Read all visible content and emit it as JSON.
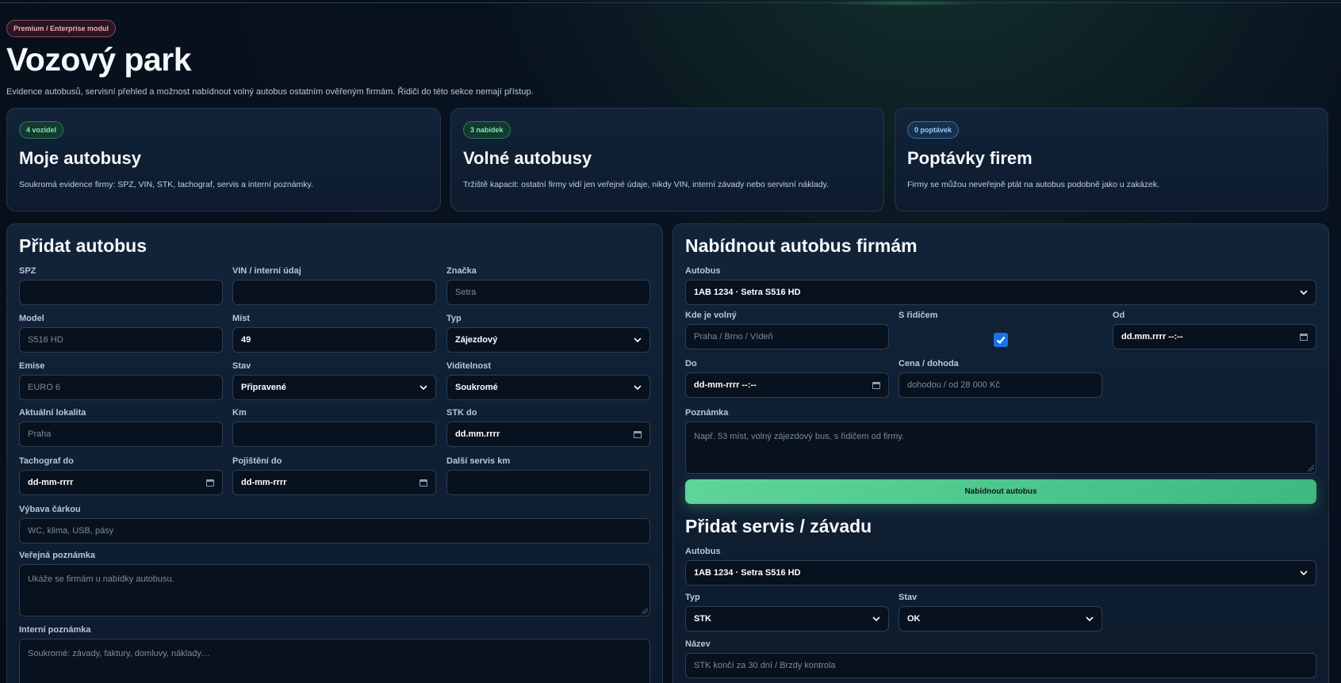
{
  "header": {
    "badge": "Premium / Enterprise modul",
    "title": "Vozový park",
    "subtitle": "Evidence autobusů, servisní přehled a možnost nabídnout volný autobus ostatním ověřeným firmám. Řidiči do této sekce nemají přístup."
  },
  "cards": [
    {
      "badge": "4 vozidel",
      "title": "Moje autobusy",
      "desc": "Soukromá evidence firmy: SPZ, VIN, STK, tachograf, servis a interní poznámky."
    },
    {
      "badge": "3 nabídek",
      "title": "Volné autobusy",
      "desc": "Tržiště kapacit: ostatní firmy vidí jen veřejné údaje, nikdy VIN, interní závady nebo servisní náklady."
    },
    {
      "badge": "0 poptávek",
      "title": "Poptávky firem",
      "desc": "Firmy se můžou neveřejně ptát na autobus podobně jako u zakázek."
    }
  ],
  "add_bus": {
    "title": "Přidat autobus",
    "spz": {
      "label": "SPZ",
      "value": ""
    },
    "vin": {
      "label": "VIN / interní údaj",
      "value": ""
    },
    "brand": {
      "label": "Značka",
      "placeholder": "Setra"
    },
    "model": {
      "label": "Model",
      "placeholder": "S516 HD"
    },
    "seats": {
      "label": "Míst",
      "value": "49"
    },
    "type": {
      "label": "Typ",
      "value": "Zájezdový"
    },
    "emission": {
      "label": "Emise",
      "placeholder": "EURO 6"
    },
    "state": {
      "label": "Stav",
      "value": "Připravené"
    },
    "visibility": {
      "label": "Viditelnost",
      "value": "Soukromé"
    },
    "location": {
      "label": "Aktuální lokalita",
      "placeholder": "Praha"
    },
    "km": {
      "label": "Km",
      "value": ""
    },
    "stk": {
      "label": "STK do",
      "value": "dd.mm.rrrr"
    },
    "tacho": {
      "label": "Tachograf do",
      "value": "dd-mm-rrrr"
    },
    "insurance": {
      "label": "Pojištění do",
      "value": "dd-mm-rrrr"
    },
    "next_service": {
      "label": "Další servis km",
      "value": ""
    },
    "equipment": {
      "label": "Výbava čárkou",
      "placeholder": "WC, klima, USB, pásy"
    },
    "public_note": {
      "label": "Veřejná poznámka",
      "placeholder": "Ukáže se firmám u nabídky autobusu."
    },
    "internal_note": {
      "label": "Interní poznámka",
      "placeholder": "Soukromé: závady, faktury, domluvy, náklady…"
    }
  },
  "offer_bus": {
    "title": "Nabídnout autobus firmám",
    "bus": {
      "label": "Autobus",
      "value": "1AB 1234 · Setra S516 HD"
    },
    "where": {
      "label": "Kde je volný",
      "placeholder": "Praha / Brno / Vídeň"
    },
    "driver": {
      "label": "S řidičem",
      "checked": true
    },
    "from": {
      "label": "Od",
      "value": "dd.mm.rrrr --:--"
    },
    "to": {
      "label": "Do",
      "value": "dd-mm-rrrr --:--"
    },
    "price": {
      "label": "Cena / dohoda",
      "placeholder": "dohodou / od 28 000 Kč"
    },
    "note": {
      "label": "Poznámka",
      "placeholder": "Např. 53 míst, volný zájezdový bus, s řidičem od firmy."
    },
    "submit": "Nabídnout autobus"
  },
  "service": {
    "title": "Přidat servis / závadu",
    "bus": {
      "label": "Autobus",
      "value": "1AB 1234 · Setra S516 HD"
    },
    "type": {
      "label": "Typ",
      "value": "STK"
    },
    "state": {
      "label": "Stav",
      "value": "OK"
    },
    "name": {
      "label": "Název",
      "placeholder": "STK končí za 30 dní / Brzdy kontrola"
    }
  }
}
